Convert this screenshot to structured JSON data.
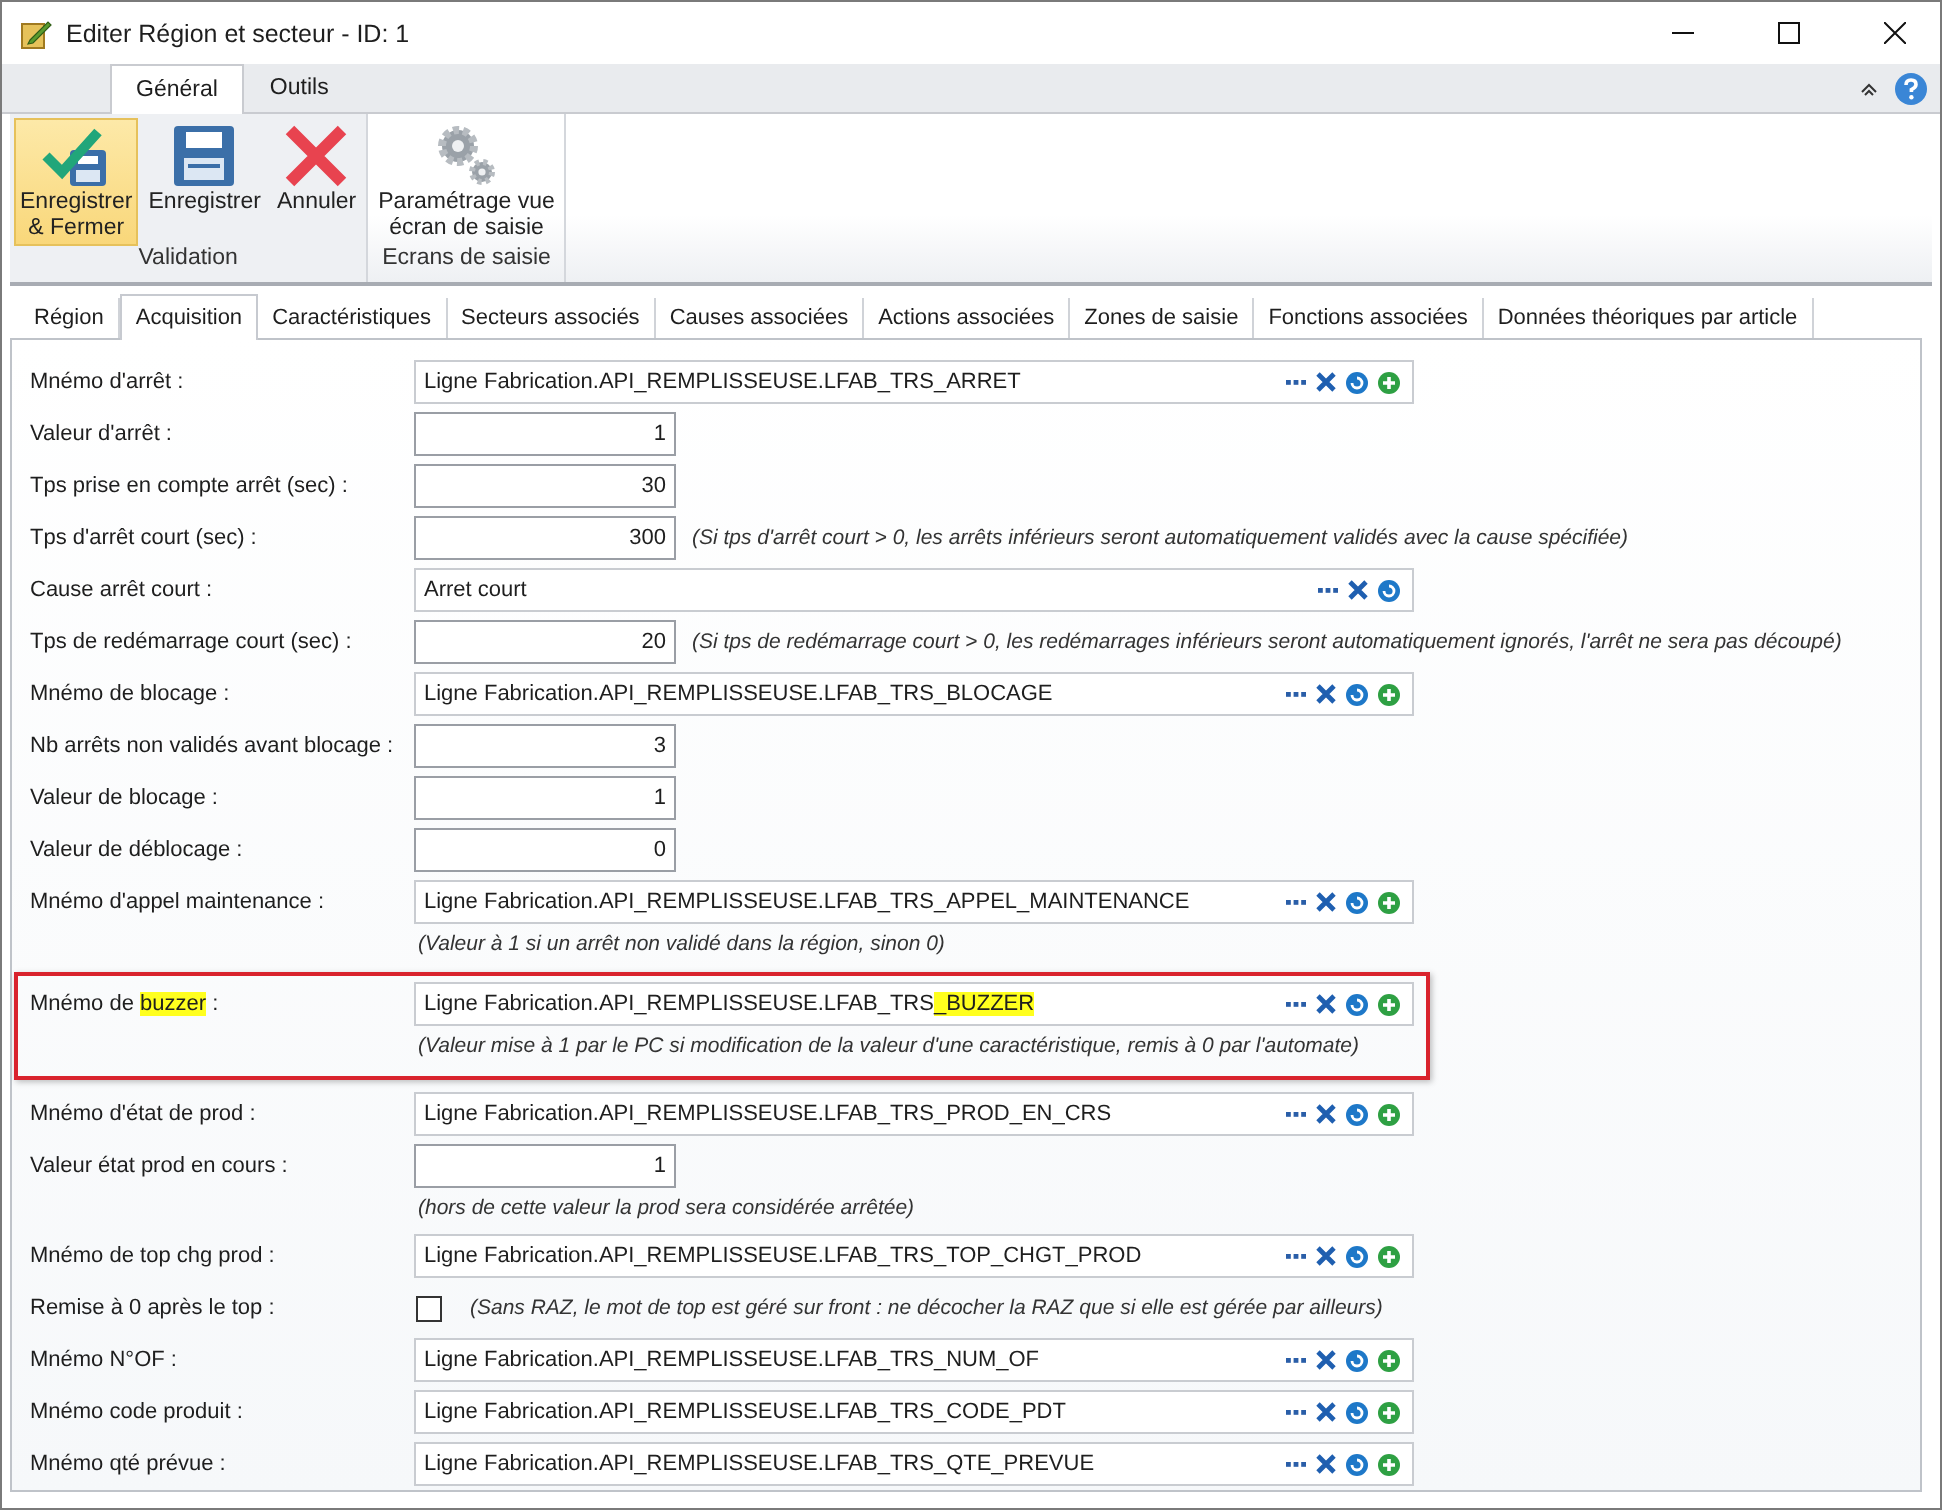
{
  "window": {
    "title": "Editer Région et secteur - ID: 1"
  },
  "ribbon": {
    "tabs": [
      {
        "label": "Général",
        "selected": true
      },
      {
        "label": "Outils",
        "selected": false
      }
    ],
    "groups": [
      {
        "title": "Validation",
        "buttons": [
          {
            "lines": [
              "Enregistrer",
              "& Fermer"
            ],
            "highlighted": true
          },
          {
            "lines": [
              "Enregistrer"
            ],
            "highlighted": false
          },
          {
            "lines": [
              "Annuler"
            ],
            "highlighted": false
          }
        ]
      },
      {
        "title": "Ecrans de saisie",
        "buttons": [
          {
            "lines": [
              "Paramétrage vue",
              "écran de saisie"
            ],
            "highlighted": false
          }
        ]
      }
    ]
  },
  "form_tabs": [
    {
      "label": "Région",
      "selected": false
    },
    {
      "label": "Acquisition",
      "selected": true
    },
    {
      "label": "Caractéristiques",
      "selected": false
    },
    {
      "label": "Secteurs associés",
      "selected": false
    },
    {
      "label": "Causes associées",
      "selected": false
    },
    {
      "label": "Actions associées",
      "selected": false
    },
    {
      "label": "Zones de saisie",
      "selected": false
    },
    {
      "label": "Fonctions associées",
      "selected": false
    },
    {
      "label": "Données théoriques par article",
      "selected": false
    }
  ],
  "rows": [
    {
      "kind": "mnemo",
      "label": "Mnémo d'arrêt :",
      "value": "Ligne Fabrication.API_REMPLISSEUSE.LFAB_TRS_ARRET",
      "can_add": true
    },
    {
      "kind": "number",
      "label": "Valeur d'arrêt :",
      "value": "1"
    },
    {
      "kind": "number",
      "label": "Tps prise en compte arrêt (sec) :",
      "value": "30"
    },
    {
      "kind": "number",
      "label": "Tps d'arrêt court (sec) :",
      "value": "300",
      "note": "(Si tps d'arrêt court > 0, les arrêts inférieurs seront automatiquement validés avec la cause spécifiée)"
    },
    {
      "kind": "mnemo",
      "label": "Cause arrêt court :",
      "value": "Arret court",
      "can_add": false
    },
    {
      "kind": "number",
      "label": "Tps de redémarrage court (sec) :",
      "value": "20",
      "note": "(Si tps de redémarrage court > 0, les redémarrages inférieurs seront automatiquement ignorés, l'arrêt ne sera pas découpé)"
    },
    {
      "kind": "mnemo",
      "label": "Mnémo de blocage :",
      "value": "Ligne Fabrication.API_REMPLISSEUSE.LFAB_TRS_BLOCAGE",
      "can_add": true
    },
    {
      "kind": "number",
      "label": "Nb arrêts non validés avant blocage :",
      "value": "3"
    },
    {
      "kind": "number",
      "label": "Valeur de blocage :",
      "value": "1"
    },
    {
      "kind": "number",
      "label": "Valeur de déblocage :",
      "value": "0"
    },
    {
      "kind": "mnemo",
      "label": "Mnémo d'appel maintenance :",
      "value": "Ligne Fabrication.API_REMPLISSEUSE.LFAB_TRS_APPEL_MAINTENANCE",
      "can_add": true,
      "note_below": "(Valeur à 1 si un arrêt non validé dans la région, sinon 0)"
    },
    {
      "kind": "mnemo",
      "outlined": true,
      "label_parts": [
        {
          "text": "Mnémo de ",
          "highlight": false
        },
        {
          "text": "buzzer",
          "highlight": true
        },
        {
          "text": " :",
          "highlight": false
        }
      ],
      "value_parts": [
        {
          "text": "Ligne Fabrication.API_REMPLISSEUSE.LFAB_TRS",
          "highlight": false
        },
        {
          "text": "_BUZZER",
          "highlight": true
        }
      ],
      "can_add": true,
      "note_below": "(Valeur mise à 1 par le PC si modification de la valeur d'une caractéristique, remis à 0 par l'automate)"
    },
    {
      "kind": "mnemo",
      "label": "Mnémo d'état de prod :",
      "value": "Ligne Fabrication.API_REMPLISSEUSE.LFAB_TRS_PROD_EN_CRS",
      "can_add": true
    },
    {
      "kind": "number",
      "label": "Valeur état prod en cours :",
      "value": "1",
      "note_below": "(hors de cette valeur la prod sera considérée arrêtée)"
    },
    {
      "kind": "mnemo",
      "label": "Mnémo de top chg prod :",
      "value": "Ligne Fabrication.API_REMPLISSEUSE.LFAB_TRS_TOP_CHGT_PROD",
      "can_add": true
    },
    {
      "kind": "checkbox",
      "label": "Remise à 0 après le top :",
      "checked": false,
      "note": "(Sans RAZ, le mot de top est géré sur front : ne décocher la RAZ que si elle est gérée par ailleurs)"
    },
    {
      "kind": "mnemo",
      "label": "Mnémo N°OF :",
      "value": "Ligne Fabrication.API_REMPLISSEUSE.LFAB_TRS_NUM_OF",
      "can_add": true
    },
    {
      "kind": "mnemo",
      "label": "Mnémo code produit :",
      "value": "Ligne Fabrication.API_REMPLISSEUSE.LFAB_TRS_CODE_PDT",
      "can_add": true
    },
    {
      "kind": "mnemo",
      "label": "Mnémo qté prévue :",
      "value": "Ligne Fabrication.API_REMPLISSEUSE.LFAB_TRS_QTE_PREVUE",
      "can_add": true
    }
  ]
}
